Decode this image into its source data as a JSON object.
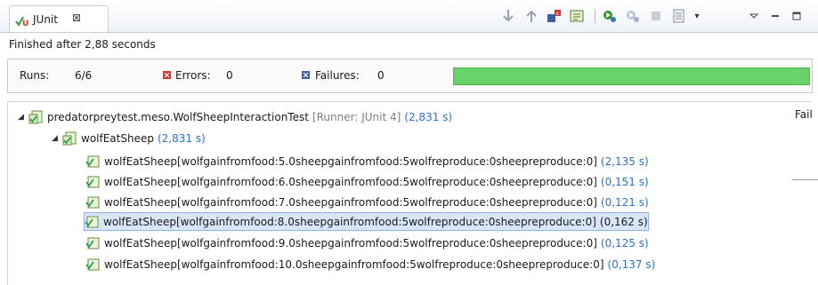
{
  "view": {
    "tab_label": "JUnit",
    "tab_close": "⊠"
  },
  "toolbar": {
    "menu_icon": "▾"
  },
  "status": {
    "text": "Finished after 2,88 seconds"
  },
  "counters": {
    "runs_label": "Runs:",
    "runs_value": "6/6",
    "errors_label": "Errors:",
    "errors_value": "0",
    "failures_label": "Failures:",
    "failures_value": "0",
    "progress_fraction": 1.0,
    "progress_color": "#6ad26a"
  },
  "trace_header": "Fail",
  "tree": {
    "root": {
      "label": "predatorpreytest.meso.WolfSheepInteractionTest",
      "runner": "[Runner: JUnit 4]",
      "time": "(2,831 s)"
    },
    "method": {
      "label": "wolfEatSheep",
      "time": "(2,831 s)"
    },
    "cases": [
      {
        "label": "wolfEatSheep[wolfgainfromfood:5.0sheepgainfromfood:5wolfreproduce:0sheepreproduce:0]",
        "time": "(2,135 s)"
      },
      {
        "label": "wolfEatSheep[wolfgainfromfood:6.0sheepgainfromfood:5wolfreproduce:0sheepreproduce:0]",
        "time": "(0,151 s)"
      },
      {
        "label": "wolfEatSheep[wolfgainfromfood:7.0sheepgainfromfood:5wolfreproduce:0sheepreproduce:0]",
        "time": "(0,121 s)"
      },
      {
        "label": "wolfEatSheep[wolfgainfromfood:8.0sheepgainfromfood:5wolfreproduce:0sheepreproduce:0]",
        "time": "(0,162 s)"
      },
      {
        "label": "wolfEatSheep[wolfgainfromfood:9.0sheepgainfromfood:5wolfreproduce:0sheepreproduce:0]",
        "time": "(0,125 s)"
      },
      {
        "label": "wolfEatSheep[wolfgainfromfood:10.0sheepgainfromfood:5wolfreproduce:0sheepreproduce:0]",
        "time": "(0,137 s)"
      }
    ]
  }
}
